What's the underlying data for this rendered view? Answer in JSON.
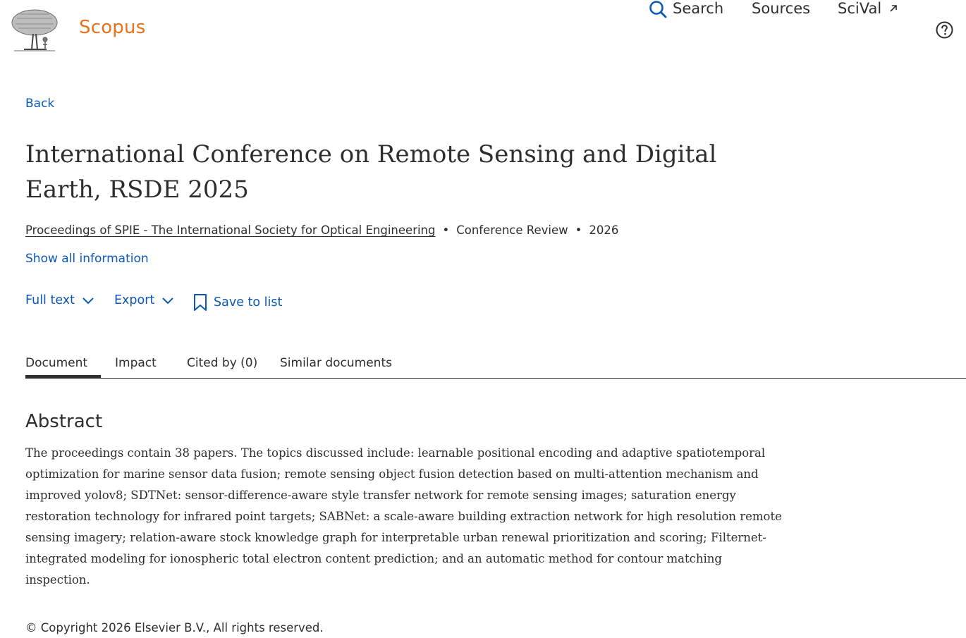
{
  "header": {
    "brand": "Scopus",
    "logo_icon": "elsevier-tree-logo",
    "nav": {
      "search_label": "Search",
      "sources_label": "Sources",
      "scival_label": "SciVal",
      "scival_icon": "external-arrow-icon",
      "help_icon": "help-circle-icon"
    }
  },
  "main": {
    "back_label": "Back",
    "title": "International Conference on Remote Sensing and Digital Earth, RSDE 2025",
    "meta": {
      "source": "Proceedings of SPIE - The International Society for Optical Engineering",
      "separator": "•",
      "doc_type": "Conference Review",
      "year": "2026"
    },
    "show_all_label": "Show all information",
    "actions": {
      "full_text": "Full text",
      "export": "Export",
      "save_to_list": "Save to list"
    },
    "tabs": [
      {
        "label": "Document",
        "active": true
      },
      {
        "label": "Impact"
      },
      {
        "label": "Cited by (0)"
      },
      {
        "label": "Similar documents"
      }
    ],
    "abstract": {
      "heading": "Abstract",
      "text": "The proceedings contain 38 papers. The topics discussed include: learnable positional encoding and adaptive spatiotemporal optimization for marine sensor data fusion; remote sensing object fusion detection based on multi-attention mechanism and improved yolov8; SDTNet: sensor-difference-aware style transfer network for remote sensing images; saturation energy restoration technology for infrared point targets; SABNet: a scale-aware building extraction network for high resolution remote sensing imagery; relation-aware stock knowledge graph for interpretable urban renewal prioritization and scoring; Filternet-integrated modeling for ionospheric total electron content prediction; and an automatic method for contour matching inspection."
    }
  },
  "footer": {
    "copyright": "© Copyright 2026 Elsevier B.V., All rights reserved."
  },
  "colors": {
    "brand": "#e9711c",
    "link": "#0c57b8",
    "text": "#2e2e2e"
  }
}
